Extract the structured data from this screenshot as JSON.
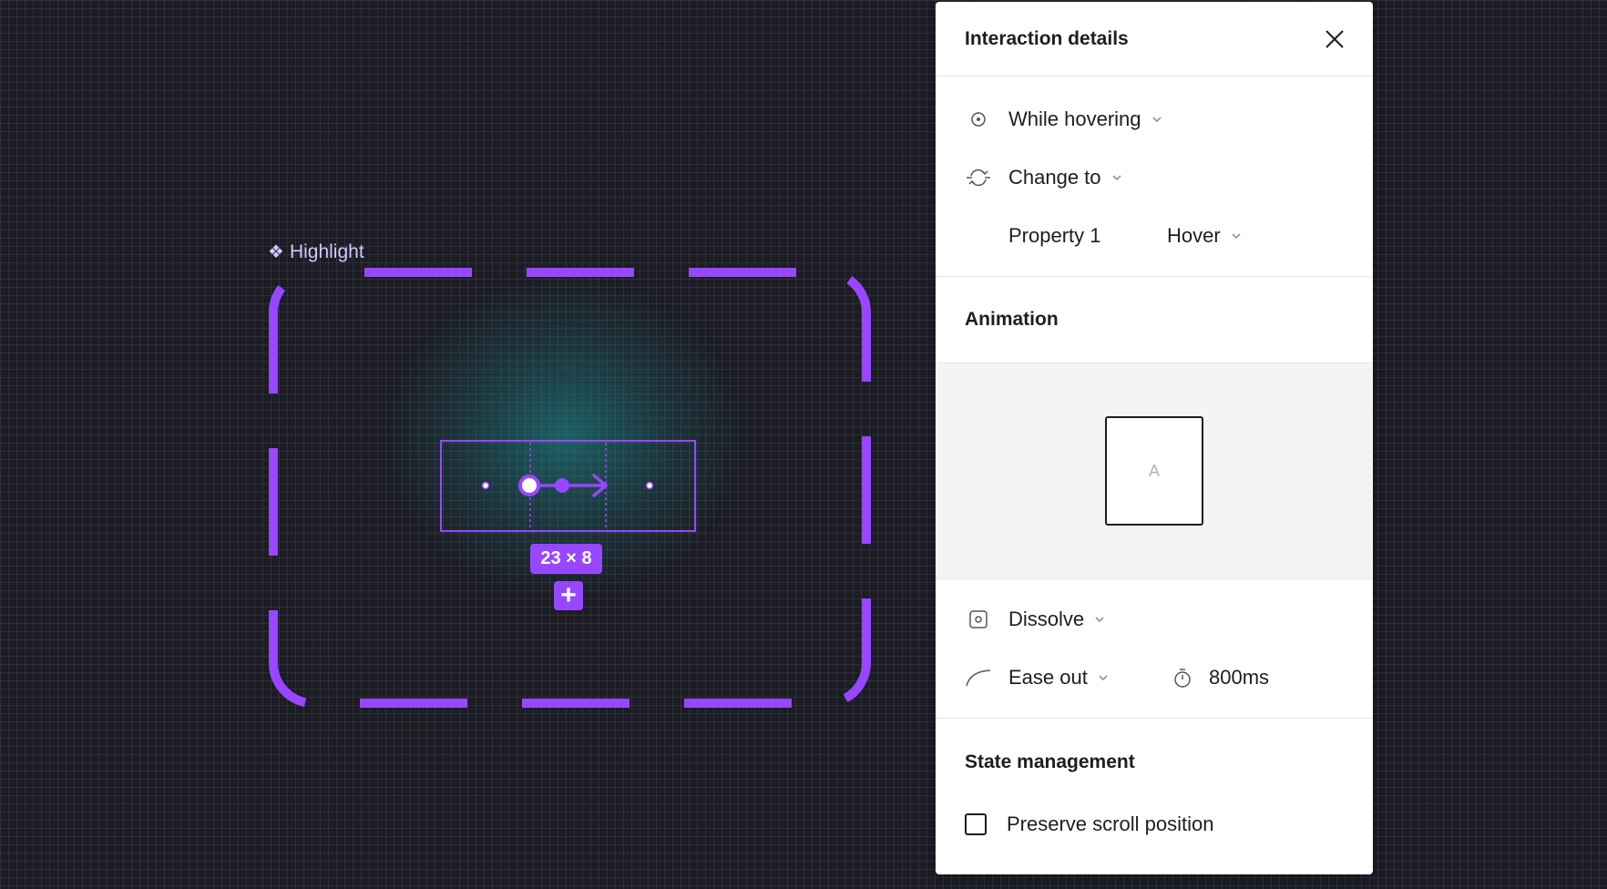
{
  "canvas": {
    "component_label": "Highlight",
    "component_icon": "component-diamond-icon",
    "size_badge": "23 × 8",
    "add_icon": "plus-icon",
    "accent_color": "#9747ff"
  },
  "panel": {
    "title": "Interaction details",
    "close_icon": "close-icon",
    "trigger": {
      "icon": "hover-target-icon",
      "label": "While hovering"
    },
    "action": {
      "icon": "change-to-icon",
      "label": "Change to"
    },
    "property": {
      "name": "Property 1",
      "value": "Hover"
    },
    "animation": {
      "title": "Animation",
      "preview_label": "A",
      "type": {
        "icon": "dissolve-icon",
        "label": "Dissolve"
      },
      "easing": {
        "icon": "ease-curve-icon",
        "label": "Ease out"
      },
      "duration": {
        "icon": "timer-icon",
        "value": "800ms"
      }
    },
    "state_management": {
      "title": "State management",
      "preserve_scroll": {
        "label": "Preserve scroll position",
        "checked": false
      }
    }
  }
}
